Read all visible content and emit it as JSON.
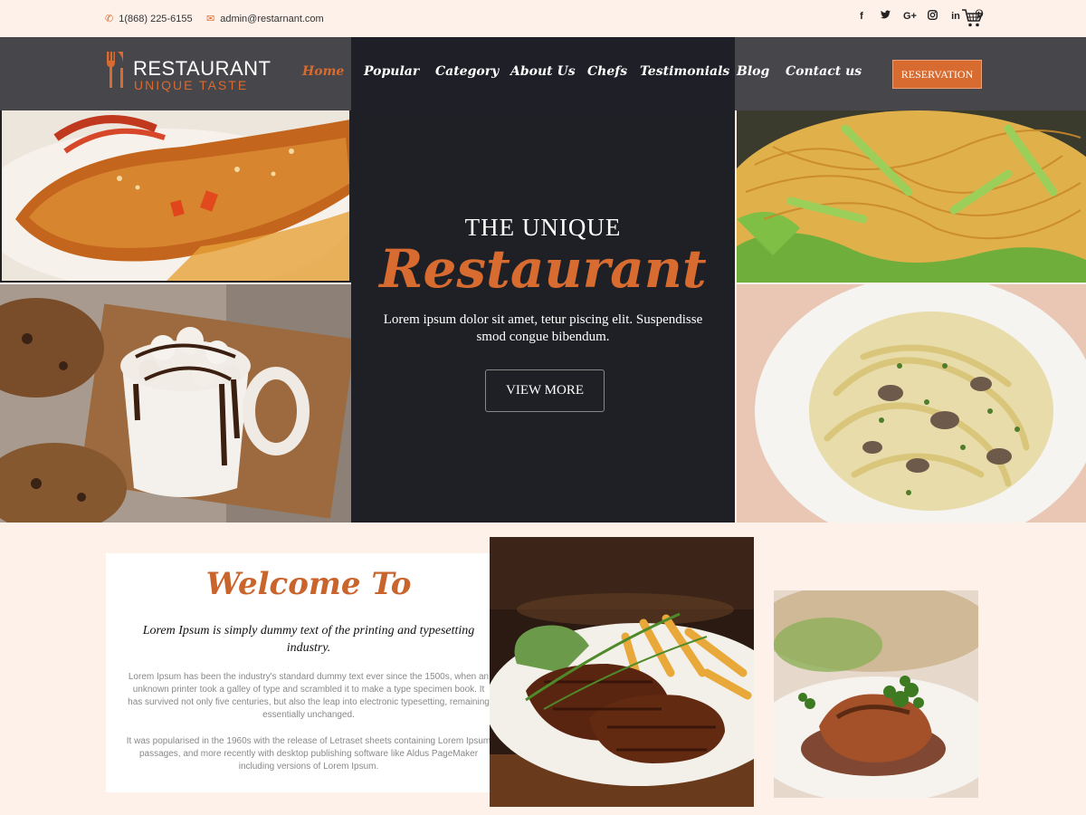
{
  "topbar": {
    "phone": "1(868) 225-6155",
    "email": "admin@restarnant.com",
    "social_icons": [
      "facebook-icon",
      "twitter-icon",
      "google-plus-icon",
      "instagram-icon",
      "linkedin-icon",
      "pinterest-icon"
    ],
    "social_glyphs": [
      "f",
      "🐦",
      "G+",
      "◎",
      "in",
      "℗"
    ],
    "cart_icon": "cart-icon"
  },
  "brand": {
    "title": "RESTAURANT",
    "subtitle": "UNIQUE TASTE",
    "accent": "#d86b2f"
  },
  "nav": {
    "items": [
      {
        "label": "Home",
        "active": true
      },
      {
        "label": "Popular",
        "active": false
      },
      {
        "label": "Category",
        "active": false
      },
      {
        "label": "About Us",
        "active": false
      },
      {
        "label": "Chefs",
        "active": false
      },
      {
        "label": "Testimonials",
        "active": false
      },
      {
        "label": "Blog",
        "active": false
      },
      {
        "label": "Contact us",
        "active": false
      }
    ],
    "reservation_label": "RESERVATION"
  },
  "hero": {
    "kicker": "THE UNIQUE",
    "title": "Restaurant",
    "text": "Lorem ipsum dolor sit amet, tetur piscing elit. Suspendisse smod congue bibendum.",
    "button_label": "VIEW MORE",
    "panel_color": "#1f2026"
  },
  "welcome": {
    "title": "Welcome To",
    "lead": "Lorem Ipsum is simply dummy text of the printing and typesetting industry.",
    "para1": "Lorem Ipsum has been the industry's standard dummy text ever since the 1500s, when an unknown printer took a galley of type and scrambled it to make a type specimen book. It has survived not only five centuries, but also the leap into electronic typesetting, remaining essentially unchanged.",
    "para2": "It was popularised in the 1960s with the release of Letraset sheets containing Lorem Ipsum passages, and more recently with desktop publishing software like Aldus PageMaker including versions of Lorem Ipsum."
  }
}
